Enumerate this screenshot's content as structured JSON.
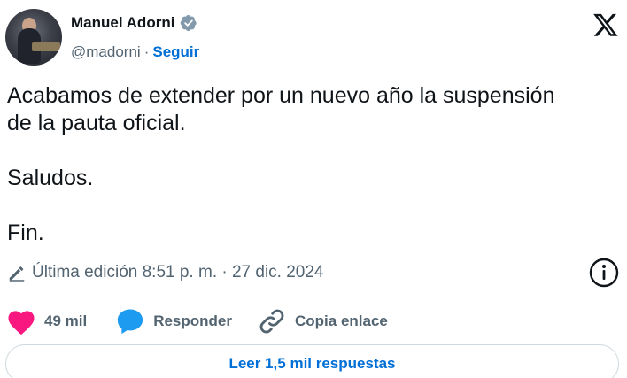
{
  "author": {
    "name": "Manuel Adorni",
    "handle": "@madorni",
    "separator": "·",
    "follow_label": "Seguir",
    "verified": true,
    "verified_color": "#829aab"
  },
  "tweet": {
    "text": "Acabamos de extender por un nuevo año la suspensión\nde la pauta oficial.\n\nSaludos.\n\nFin.",
    "edited_label": "Última edición 8:51 p. m. · 27 dic. 2024"
  },
  "actions": {
    "like_count": "49 mil",
    "like_color": "#f91880",
    "reply_label": "Responder",
    "reply_color": "#1d9bf0",
    "copy_label": "Copia enlace"
  },
  "read_replies_label": "Leer 1,5 mil respuestas",
  "colors": {
    "link_blue": "#006fd6",
    "secondary_text": "#536471",
    "primary_text": "#0f1419"
  },
  "icons": {
    "platform": "x-logo-icon",
    "verified": "verified-badge-icon",
    "edited": "pencil-icon",
    "info": "info-icon",
    "like": "heart-icon",
    "reply": "speech-bubble-icon",
    "copy": "link-icon"
  }
}
